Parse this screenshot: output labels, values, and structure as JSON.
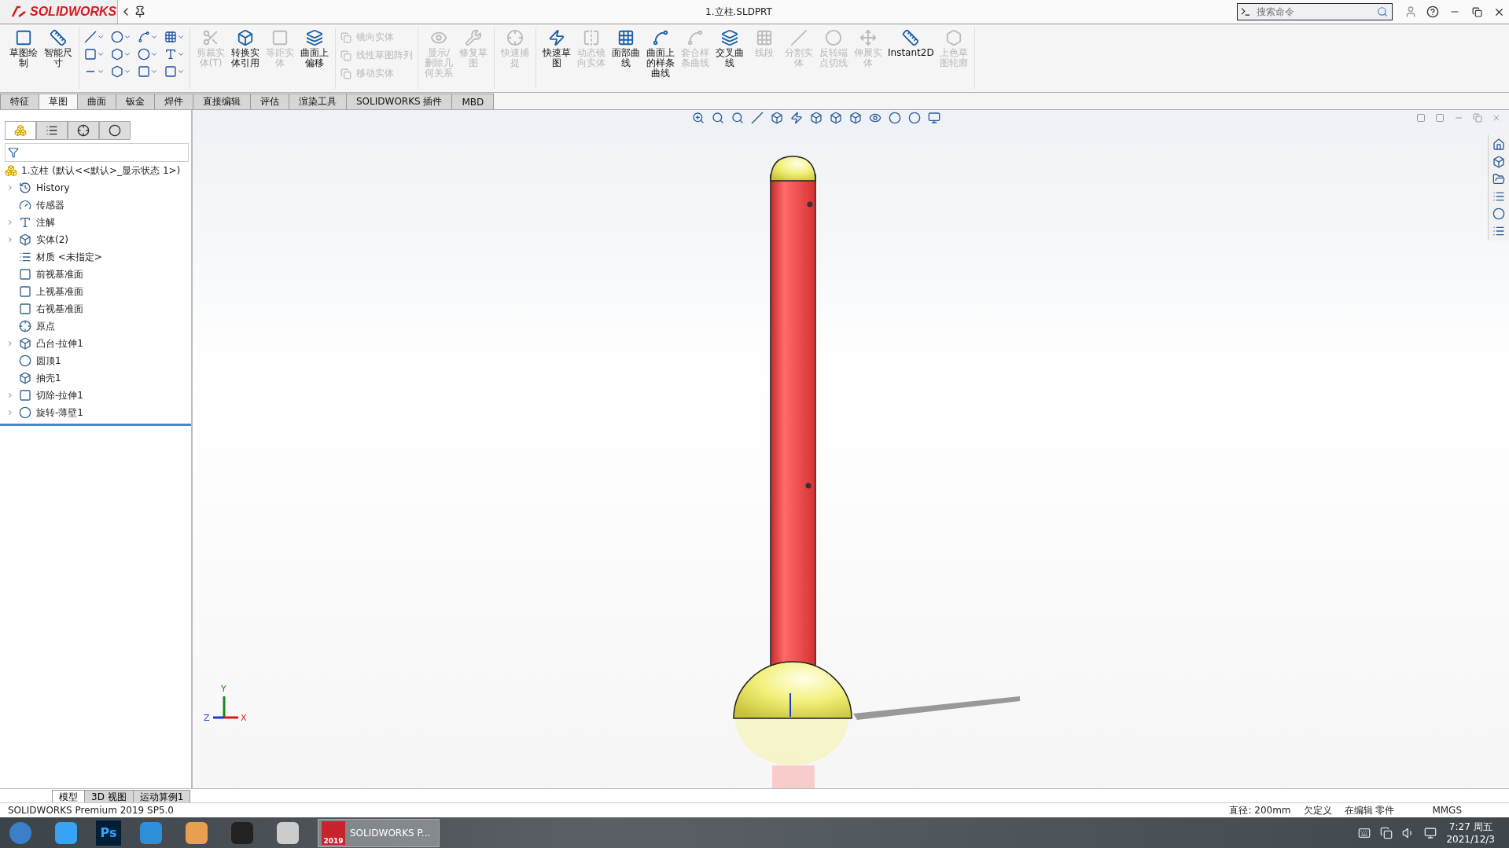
{
  "window": {
    "logo": "SOLIDWORKS",
    "title": "1.立柱.SLDPRT",
    "search": {
      "placeholder": "搜索命令"
    }
  },
  "command_manager": {
    "groups": [
      {
        "kind": "buttons",
        "items": [
          {
            "label": "草图绘制",
            "disabled": false
          },
          {
            "label": "智能尺寸",
            "disabled": false
          }
        ]
      },
      {
        "kind": "tools"
      },
      {
        "kind": "buttons",
        "items": [
          {
            "label": "剪裁实体(T)",
            "disabled": true
          },
          {
            "label": "转换实体引用",
            "disabled": false
          },
          {
            "label": "等距实体",
            "disabled": true
          },
          {
            "label": "曲面上偏移",
            "disabled": false
          }
        ]
      },
      {
        "kind": "list",
        "items": [
          {
            "label": "镜向实体",
            "disabled": true
          },
          {
            "label": "线性草图阵列",
            "disabled": true
          },
          {
            "label": "移动实体",
            "disabled": true
          }
        ]
      },
      {
        "kind": "buttons",
        "items": [
          {
            "label": "显示/删除几何关系",
            "disabled": true
          },
          {
            "label": "修复草图",
            "disabled": true
          }
        ]
      },
      {
        "kind": "buttons",
        "items": [
          {
            "label": "快速捕捉",
            "disabled": true
          }
        ]
      },
      {
        "kind": "buttons",
        "items": [
          {
            "label": "快速草图",
            "disabled": false
          },
          {
            "label": "动态镜向实体",
            "disabled": true
          },
          {
            "label": "面部曲线",
            "disabled": false
          },
          {
            "label": "曲面上的样条曲线",
            "disabled": false
          },
          {
            "label": "套合样条曲线",
            "disabled": true
          },
          {
            "label": "交叉曲线",
            "disabled": false
          },
          {
            "label": "线段",
            "disabled": true
          },
          {
            "label": "分割实体",
            "disabled": true
          },
          {
            "label": "反转端点切线",
            "disabled": true
          },
          {
            "label": "伸展实体",
            "disabled": true
          },
          {
            "label": "Instant2D",
            "disabled": false
          },
          {
            "label": "上色草图轮廓",
            "disabled": true
          }
        ]
      }
    ]
  },
  "tabs": [
    {
      "label": "特征",
      "selected": false
    },
    {
      "label": "草图",
      "selected": true
    },
    {
      "label": "曲面",
      "selected": false
    },
    {
      "label": "钣金",
      "selected": false
    },
    {
      "label": "焊件",
      "selected": false
    },
    {
      "label": "直接编辑",
      "selected": false
    },
    {
      "label": "评估",
      "selected": false
    },
    {
      "label": "渲染工具",
      "selected": false
    },
    {
      "label": "SOLIDWORKS 插件",
      "selected": false
    },
    {
      "label": "MBD",
      "selected": false
    }
  ],
  "panel_tabs": [
    {
      "selected": true
    },
    {
      "selected": false
    },
    {
      "selected": false
    },
    {
      "selected": false
    }
  ],
  "tree": {
    "root": "1.立柱  (默认<<默认>_显示状态 1>)",
    "items": [
      {
        "label": "History",
        "expandable": true
      },
      {
        "label": "传感器",
        "expandable": false
      },
      {
        "label": "注解",
        "expandable": true
      },
      {
        "label": "实体(2)",
        "expandable": true
      },
      {
        "label": "材质 <未指定>",
        "expandable": false
      },
      {
        "label": "前视基准面",
        "expandable": false
      },
      {
        "label": "上视基准面",
        "expandable": false
      },
      {
        "label": "右视基准面",
        "expandable": false
      },
      {
        "label": "原点",
        "expandable": false
      },
      {
        "label": "凸台-拉伸1",
        "expandable": true
      },
      {
        "label": "圆顶1",
        "expandable": false
      },
      {
        "label": "抽壳1",
        "expandable": false
      },
      {
        "label": "切除-拉伸1",
        "expandable": true
      },
      {
        "label": "旋转-薄壁1",
        "expandable": true
      }
    ]
  },
  "viewport": {
    "triad": [
      "Y",
      "Z",
      "X"
    ]
  },
  "model_tabs": [
    {
      "label": "模型",
      "selected": true
    },
    {
      "label": "3D 视图",
      "selected": false
    },
    {
      "label": "运动算例1",
      "selected": false
    }
  ],
  "status_bar": {
    "product": "SOLIDWORKS Premium 2019 SP5.0",
    "measure": "直径: 200mm",
    "state": "欠定义",
    "mode": "在编辑 零件",
    "units": "MMGS"
  },
  "taskbar": {
    "apps": [
      {
        "kind": "start"
      },
      {
        "kind": "cloud"
      },
      {
        "kind": "ps",
        "label": "Ps"
      },
      {
        "kind": "lens"
      },
      {
        "kind": "mail"
      },
      {
        "kind": "video"
      },
      {
        "kind": "scissors"
      },
      {
        "kind": "solidworks",
        "badge": "2019",
        "label": "SOLIDWORKS P...",
        "selected": true
      }
    ],
    "time": "7:27 周五",
    "date": "2021/12/3"
  }
}
